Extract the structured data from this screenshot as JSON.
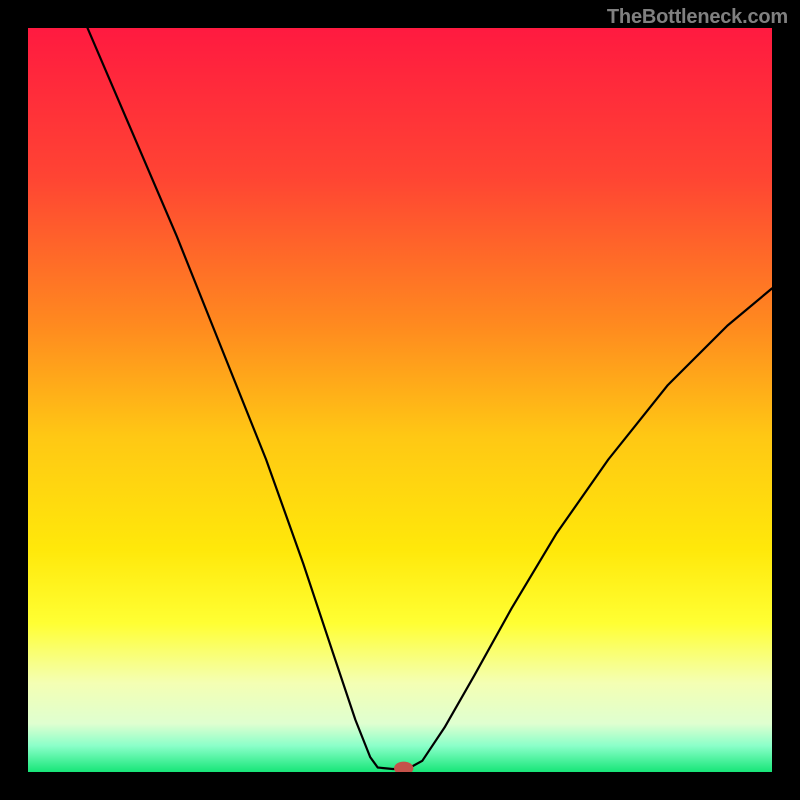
{
  "watermark": "TheBottleneck.com",
  "chart_data": {
    "type": "line",
    "title": "",
    "xlabel": "",
    "ylabel": "",
    "xlim": [
      0,
      100
    ],
    "ylim": [
      0,
      100
    ],
    "grid": false,
    "legend": false,
    "background_gradient": {
      "stops": [
        {
          "offset": 0.0,
          "color": "#ff1a40"
        },
        {
          "offset": 0.2,
          "color": "#ff4433"
        },
        {
          "offset": 0.4,
          "color": "#ff8a1f"
        },
        {
          "offset": 0.55,
          "color": "#ffc814"
        },
        {
          "offset": 0.7,
          "color": "#ffe80a"
        },
        {
          "offset": 0.8,
          "color": "#ffff33"
        },
        {
          "offset": 0.88,
          "color": "#f4ffb3"
        },
        {
          "offset": 0.935,
          "color": "#dfffd0"
        },
        {
          "offset": 0.965,
          "color": "#8affc9"
        },
        {
          "offset": 1.0,
          "color": "#17e678"
        }
      ]
    },
    "curve": {
      "color": "#000000",
      "width": 2.2,
      "points": [
        {
          "x": 8,
          "y": 100
        },
        {
          "x": 14,
          "y": 86
        },
        {
          "x": 20,
          "y": 72
        },
        {
          "x": 26,
          "y": 57
        },
        {
          "x": 32,
          "y": 42
        },
        {
          "x": 37,
          "y": 28
        },
        {
          "x": 41,
          "y": 16
        },
        {
          "x": 44,
          "y": 7
        },
        {
          "x": 46,
          "y": 2
        },
        {
          "x": 47,
          "y": 0.6
        },
        {
          "x": 49,
          "y": 0.4
        },
        {
          "x": 50,
          "y": 0.4
        },
        {
          "x": 51,
          "y": 0.4
        },
        {
          "x": 53,
          "y": 1.5
        },
        {
          "x": 56,
          "y": 6
        },
        {
          "x": 60,
          "y": 13
        },
        {
          "x": 65,
          "y": 22
        },
        {
          "x": 71,
          "y": 32
        },
        {
          "x": 78,
          "y": 42
        },
        {
          "x": 86,
          "y": 52
        },
        {
          "x": 94,
          "y": 60
        },
        {
          "x": 100,
          "y": 65
        }
      ]
    },
    "marker": {
      "x": 50.5,
      "y": 0.5,
      "rx": 1.3,
      "ry": 0.9,
      "color": "#c4524a"
    }
  }
}
